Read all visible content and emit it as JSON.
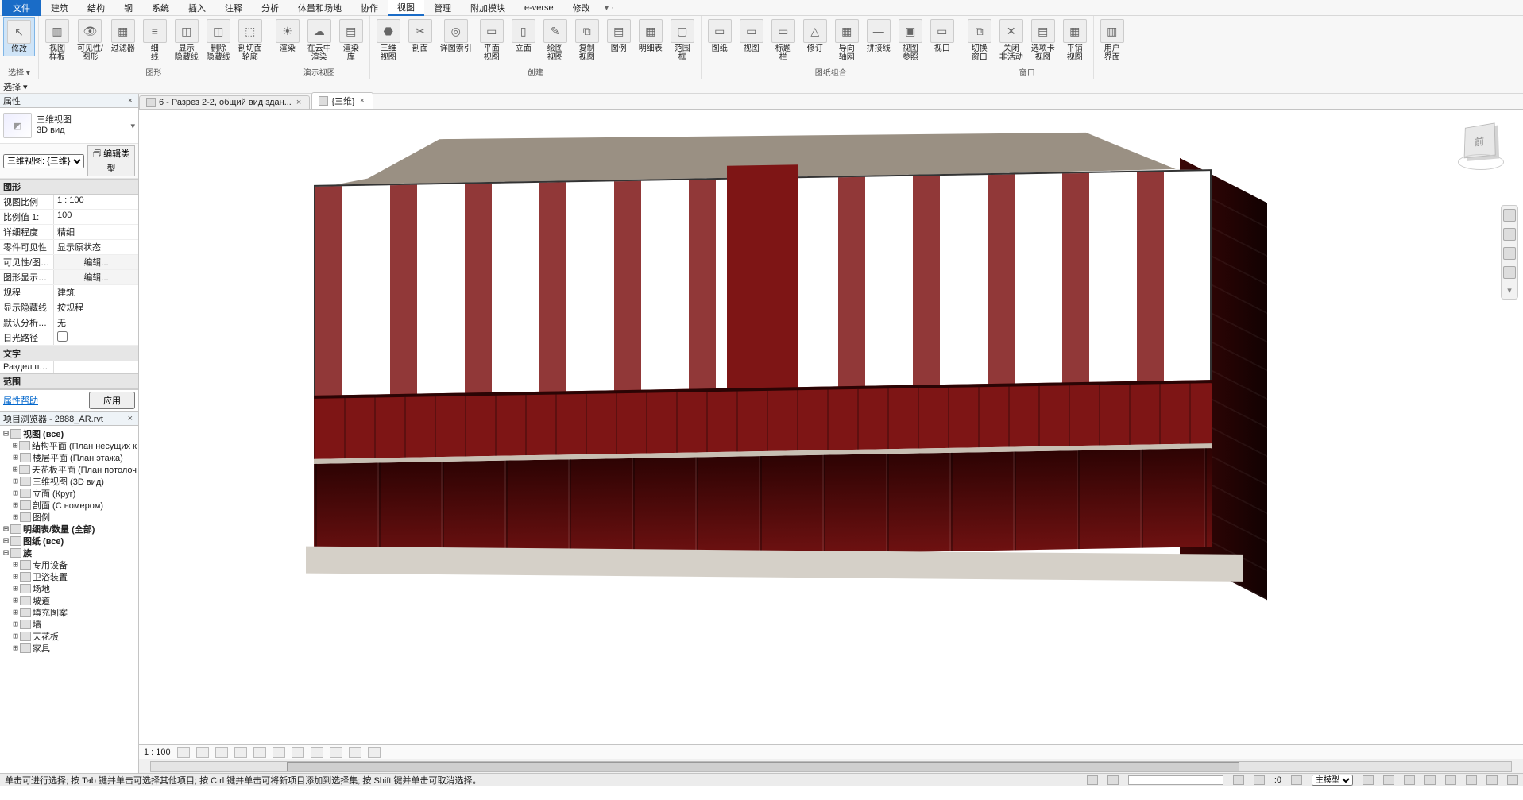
{
  "menu": {
    "file": "文件",
    "tabs": [
      "建筑",
      "结构",
      "钢",
      "系统",
      "插入",
      "注释",
      "分析",
      "体量和场地",
      "协作",
      "视图",
      "管理",
      "附加模块",
      "e-verse",
      "修改"
    ],
    "active": "视图",
    "tail": "▾ ·"
  },
  "ribbon": {
    "groups": [
      {
        "label": "选择 ▾",
        "items": [
          {
            "id": "modify",
            "txt": "修改",
            "glyph": "↖",
            "active": true
          }
        ]
      },
      {
        "label": "图形",
        "items": [
          {
            "id": "view-templates",
            "txt": "视图\n样板",
            "glyph": "▥"
          },
          {
            "id": "visibility",
            "txt": "可见性/\n图形",
            "glyph": "👁"
          },
          {
            "id": "filters",
            "txt": "过滤器",
            "glyph": "▦"
          },
          {
            "id": "thin-lines",
            "txt": "细\n线",
            "glyph": "≡"
          },
          {
            "id": "show-hidden",
            "txt": "显示\n隐藏线",
            "glyph": "◫"
          },
          {
            "id": "remove-hidden",
            "txt": "删除\n隐藏线",
            "glyph": "◫"
          },
          {
            "id": "cut-profile",
            "txt": "剖切面\n轮廓",
            "glyph": "⬚"
          }
        ]
      },
      {
        "label": "演示视图",
        "items": [
          {
            "id": "render",
            "txt": "渲染",
            "glyph": "☀"
          },
          {
            "id": "render-cloud",
            "txt": "在云中\n渲染",
            "glyph": "☁"
          },
          {
            "id": "render-gallery",
            "txt": "渲染\n库",
            "glyph": "▤"
          }
        ]
      },
      {
        "label": "创建",
        "items": [
          {
            "id": "3d-view",
            "txt": "三维\n视图",
            "glyph": "⬣"
          },
          {
            "id": "section",
            "txt": "剖面",
            "glyph": "✂"
          },
          {
            "id": "detail",
            "txt": "详图索引",
            "glyph": "◎"
          },
          {
            "id": "plan",
            "txt": "平面\n视图",
            "glyph": "▭"
          },
          {
            "id": "elevation",
            "txt": "立面",
            "glyph": "▯"
          },
          {
            "id": "drafting",
            "txt": "绘图\n视图",
            "glyph": "✎"
          },
          {
            "id": "duplicate",
            "txt": "复制\n视图",
            "glyph": "⧉"
          },
          {
            "id": "legend",
            "txt": "图例",
            "glyph": "▤"
          },
          {
            "id": "schedule",
            "txt": "明细表",
            "glyph": "▦"
          },
          {
            "id": "scope-box",
            "txt": "范围\n框",
            "glyph": "▢"
          }
        ]
      },
      {
        "label": "图纸组合",
        "items": [
          {
            "id": "sheet",
            "txt": "图纸",
            "glyph": "▭"
          },
          {
            "id": "view",
            "txt": "视图",
            "glyph": "▭"
          },
          {
            "id": "title-block",
            "txt": "标题\n栏",
            "glyph": "▭"
          },
          {
            "id": "revisions",
            "txt": "修订",
            "glyph": "△"
          },
          {
            "id": "guide-grid",
            "txt": "导向\n轴网",
            "glyph": "▦"
          },
          {
            "id": "matchline",
            "txt": "拼接线",
            "glyph": "—"
          },
          {
            "id": "view-ref",
            "txt": "视图\n参照",
            "glyph": "▣"
          },
          {
            "id": "viewport",
            "txt": "视口",
            "glyph": "▭"
          }
        ]
      },
      {
        "label": "窗口",
        "items": [
          {
            "id": "switch-window",
            "txt": "切换\n窗口",
            "glyph": "⧉"
          },
          {
            "id": "close-inactive",
            "txt": "关闭\n非活动",
            "glyph": "✕"
          },
          {
            "id": "tab-view",
            "txt": "选项卡\n视图",
            "glyph": "▤"
          },
          {
            "id": "tile-view",
            "txt": "平铺\n视图",
            "glyph": "▦"
          }
        ]
      },
      {
        "label": "",
        "items": [
          {
            "id": "user-interface",
            "txt": "用户\n界面",
            "glyph": "▥"
          }
        ]
      }
    ]
  },
  "select_strip": {
    "label": "选择 ▾"
  },
  "props": {
    "title": "属性",
    "type_line1": "三维视图",
    "type_line2": "3D вид",
    "instance": "三维视图: {三维}",
    "edit_type": "编辑类型",
    "cats": [
      {
        "name": "图形",
        "rows": [
          {
            "k": "视图比例",
            "v": "1 : 100"
          },
          {
            "k": "比例值 1:",
            "v": "100"
          },
          {
            "k": "详细程度",
            "v": "精细"
          },
          {
            "k": "零件可见性",
            "v": "显示原状态"
          },
          {
            "k": "可见性/图形...",
            "v": "编辑...",
            "btn": true
          },
          {
            "k": "图形显示选项",
            "v": "编辑...",
            "btn": true
          },
          {
            "k": "规程",
            "v": "建筑"
          },
          {
            "k": "显示隐藏线",
            "v": "按规程"
          },
          {
            "k": "默认分析显示...",
            "v": "无"
          },
          {
            "k": "日光路径",
            "v": "",
            "check": false
          }
        ]
      },
      {
        "name": "文字",
        "rows": [
          {
            "k": "Раздел про...",
            "v": ""
          }
        ]
      },
      {
        "name": "范围",
        "rows": []
      }
    ],
    "help": "属性帮助",
    "apply": "应用"
  },
  "browser": {
    "title": "项目浏览器 - 2888_AR.rvt",
    "tree": [
      {
        "lvl": 0,
        "tw": "⊟",
        "txt": "视图 (все)"
      },
      {
        "lvl": 1,
        "tw": "⊞",
        "txt": "结构平面 (План несущих к"
      },
      {
        "lvl": 1,
        "tw": "⊞",
        "txt": "楼层平面 (План этажа)"
      },
      {
        "lvl": 1,
        "tw": "⊞",
        "txt": "天花板平面 (План потолоч"
      },
      {
        "lvl": 1,
        "tw": "⊞",
        "txt": "三维视图 (3D вид)"
      },
      {
        "lvl": 1,
        "tw": "⊞",
        "txt": "立面 (Круг)"
      },
      {
        "lvl": 1,
        "tw": "⊞",
        "txt": "剖面 (С номером)"
      },
      {
        "lvl": 1,
        "tw": "⊞",
        "txt": "图例"
      },
      {
        "lvl": 0,
        "tw": "⊞",
        "txt": "明细表/数量 (全部)"
      },
      {
        "lvl": 0,
        "tw": "⊞",
        "txt": "图纸 (все)"
      },
      {
        "lvl": 0,
        "tw": "⊟",
        "txt": "族"
      },
      {
        "lvl": 1,
        "tw": "⊞",
        "txt": "专用设备"
      },
      {
        "lvl": 1,
        "tw": "⊞",
        "txt": "卫浴装置"
      },
      {
        "lvl": 1,
        "tw": "⊞",
        "txt": "场地"
      },
      {
        "lvl": 1,
        "tw": "⊞",
        "txt": "坡道"
      },
      {
        "lvl": 1,
        "tw": "⊞",
        "txt": "填充图案"
      },
      {
        "lvl": 1,
        "tw": "⊞",
        "txt": "墙"
      },
      {
        "lvl": 1,
        "tw": "⊞",
        "txt": "天花板"
      },
      {
        "lvl": 1,
        "tw": "⊞",
        "txt": "家具"
      }
    ]
  },
  "view_tabs": [
    {
      "id": "t1",
      "label": "6 - Разрез 2-2, общий вид здан...",
      "active": false
    },
    {
      "id": "t2",
      "label": "{三维}",
      "active": true
    }
  ],
  "viewcube": {
    "face": "前"
  },
  "view_ctrl": {
    "scale": "1 : 100"
  },
  "status": {
    "msg": "单击可进行选择; 按 Tab 键并单击可选择其他项目; 按 Ctrl 键并单击可将新项目添加到选择集; 按 Shift 键并单击可取消选择。",
    "count": ":0",
    "model": "主模型"
  }
}
